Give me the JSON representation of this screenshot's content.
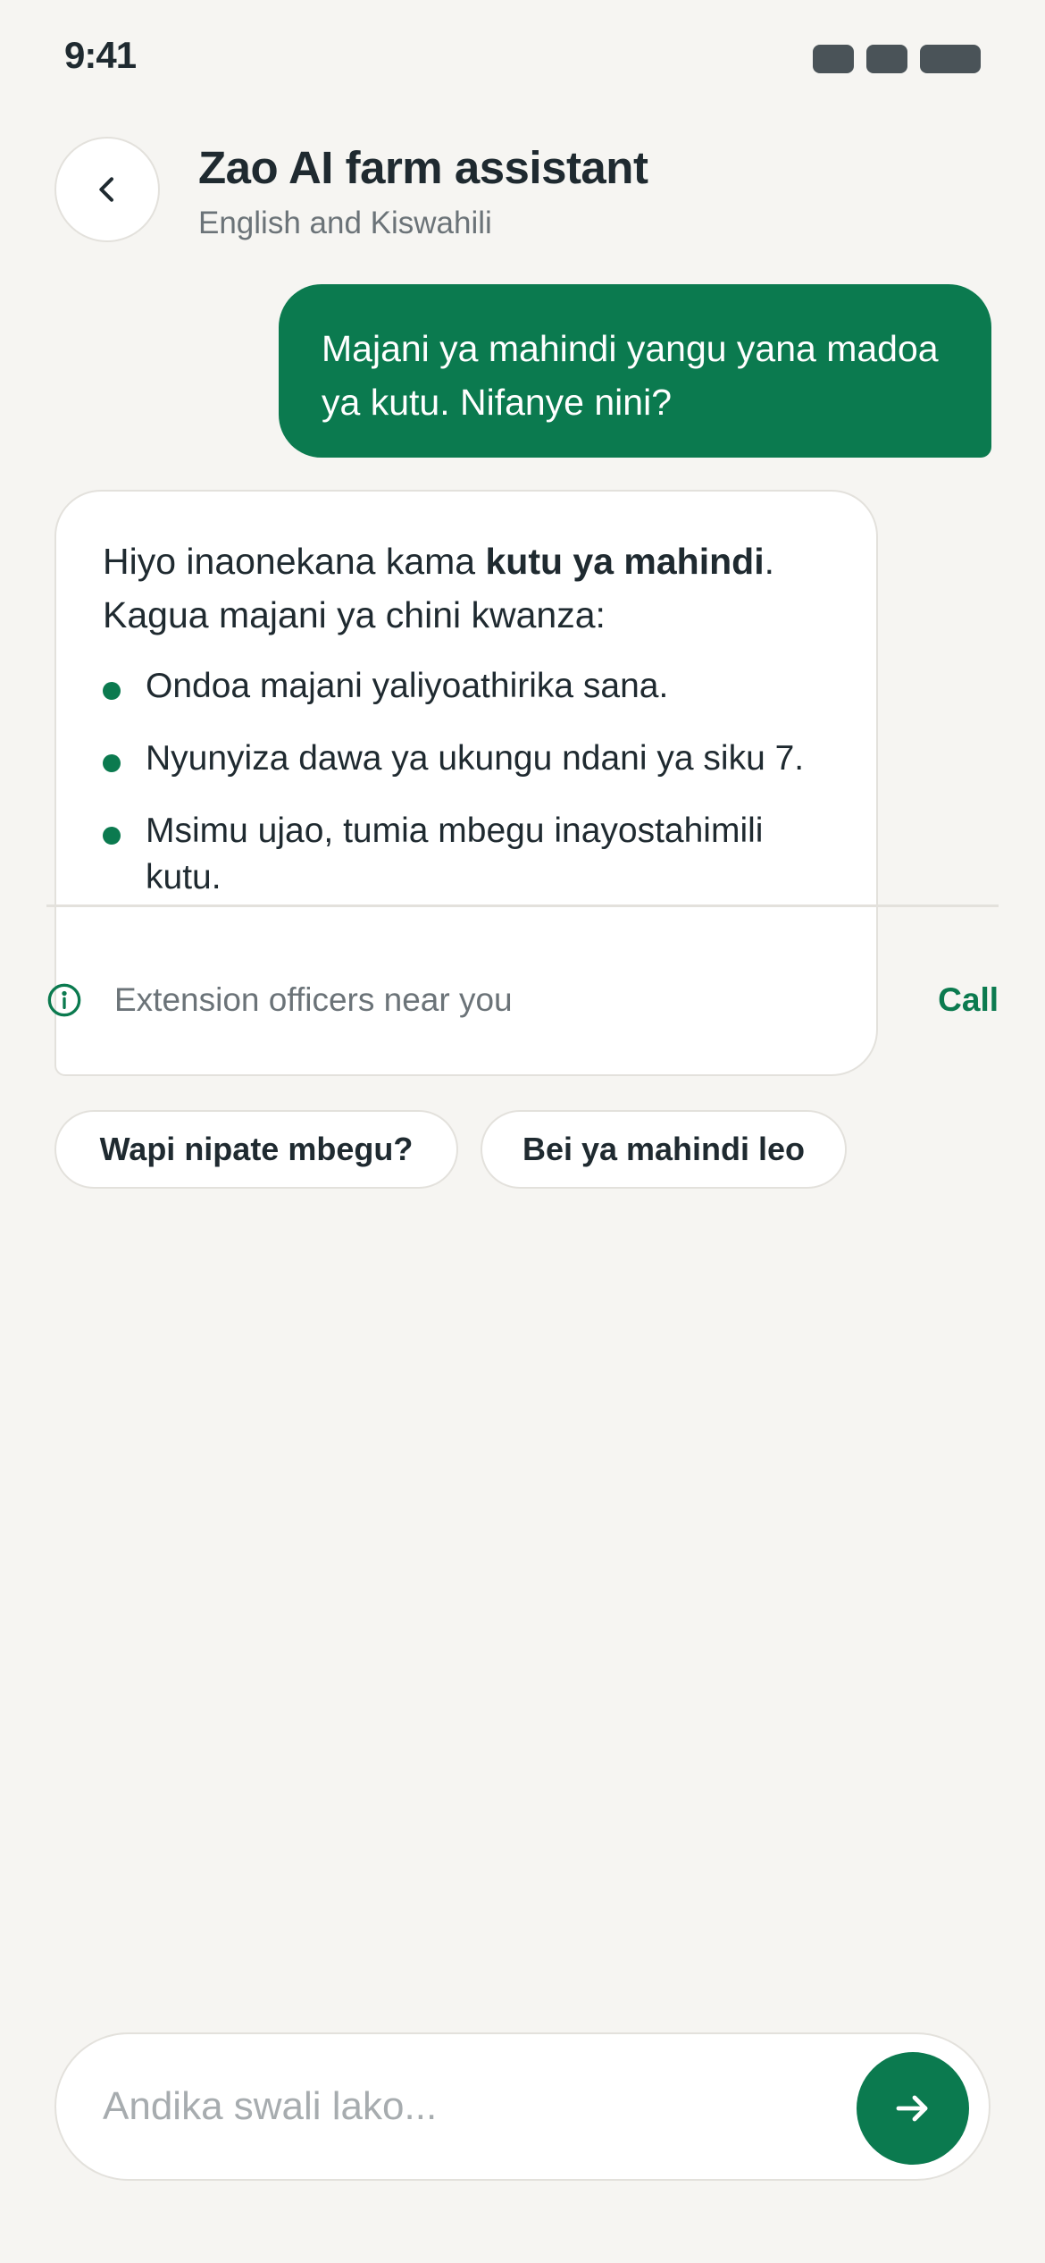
{
  "status_bar": {
    "time": "9:41"
  },
  "header": {
    "title": "Zao AI farm assistant",
    "subtitle": "English and Kiswahili"
  },
  "user_message": {
    "text": "Majani ya mahindi yangu yana madoa ya kutu. Nifanye nini?"
  },
  "assistant_message": {
    "intro_before": "Hiyo inaonekana kama ",
    "intro_bold": "kutu ya mahindi",
    "intro_after": ". Kagua majani ya chini kwanza:",
    "tips": [
      "Ondoa majani yaliyoathirika sana.",
      "Nyunyiza dawa ya ukungu ndani ya siku 7.",
      "Msimu ujao, tumia mbegu inayostahimili kutu."
    ],
    "officers_label": "Extension officers near you",
    "call_label": "Call"
  },
  "suggestions": [
    "Wapi nipate mbegu?",
    "Bei ya mahindi leo"
  ],
  "composer": {
    "placeholder": "Andika swali lako..."
  },
  "colors": {
    "accent": "#0b7a4f",
    "background": "#f6f5f2",
    "text": "#1f2a30"
  },
  "icons": {
    "back": "chevron-left-icon",
    "info": "info-icon",
    "send": "arrow-right-icon"
  }
}
